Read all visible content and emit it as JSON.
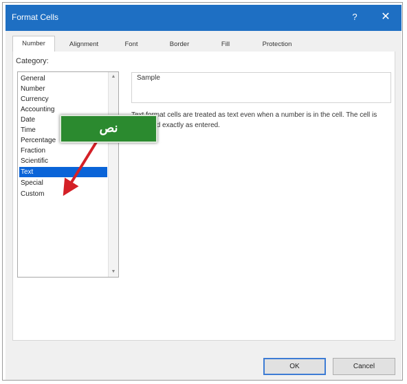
{
  "window": {
    "title": "Format Cells",
    "help_glyph": "?",
    "close_glyph": "✕"
  },
  "tabs": [
    "Number",
    "Alignment",
    "Font",
    "Border",
    "Fill",
    "Protection"
  ],
  "category": {
    "label": "Category:",
    "items": [
      "General",
      "Number",
      "Currency",
      "Accounting",
      "Date",
      "Time",
      "Percentage",
      "Fraction",
      "Scientific",
      "Text",
      "Special",
      "Custom"
    ],
    "selected": "Text"
  },
  "sample": {
    "label": "Sample"
  },
  "description": "Text format cells are treated as text even when a number is in the cell. The cell is displayed exactly as entered.",
  "callout": {
    "text": "نص",
    "color": "#2b8a2f",
    "arrow_color": "#d42027"
  },
  "buttons": {
    "ok": "OK",
    "cancel": "Cancel"
  },
  "colors": {
    "titlebar": "#1e6fc3",
    "selection": "#0a64d8"
  }
}
